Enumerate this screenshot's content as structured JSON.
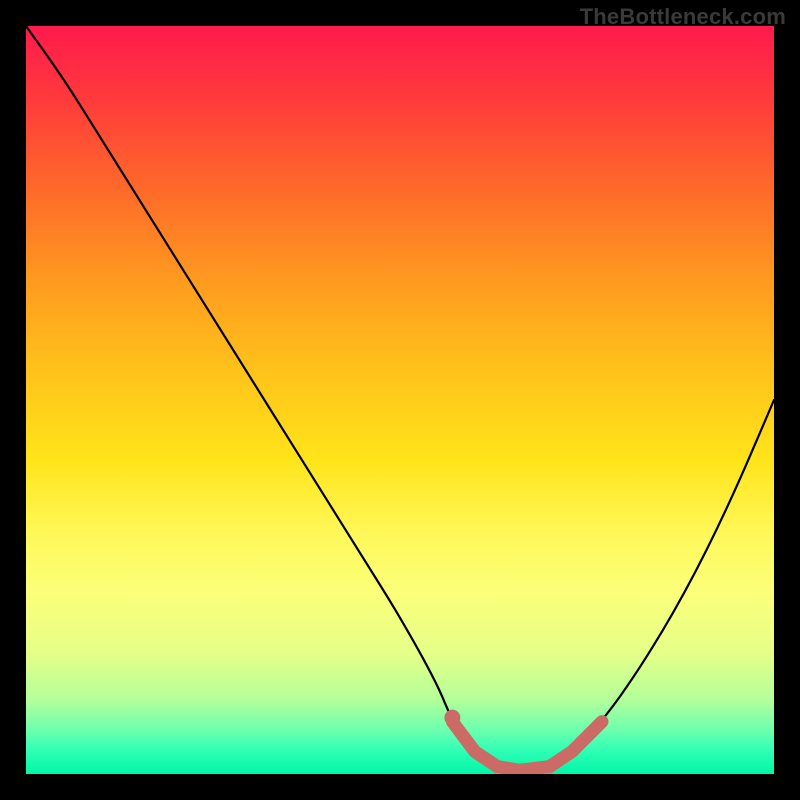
{
  "watermark": "TheBottleneck.com",
  "colors": {
    "curve": "#000000",
    "overlay": "#cc6b66",
    "background_frame": "#000000"
  },
  "chart_data": {
    "type": "line",
    "title": "",
    "xlabel": "",
    "ylabel": "",
    "xlim": [
      0,
      100
    ],
    "ylim": [
      0,
      100
    ],
    "grid": false,
    "legend": false,
    "axes_visible": false,
    "series": [
      {
        "name": "bottleneck-curve",
        "x": [
          0,
          5,
          10,
          15,
          20,
          25,
          30,
          35,
          40,
          45,
          50,
          55,
          57,
          60,
          63,
          66,
          70,
          73,
          77,
          82,
          88,
          94,
          100
        ],
        "y": [
          100,
          93,
          85,
          77,
          69,
          61,
          53,
          45,
          37,
          29,
          21,
          12,
          7,
          3,
          1,
          0.5,
          1,
          3,
          7,
          14,
          24,
          36,
          50
        ]
      }
    ],
    "highlight": {
      "name": "optimal-range",
      "x_start": 57,
      "x_end": 77,
      "y_at_start": 7,
      "y_at_end": 7,
      "minimum_x": 66,
      "minimum_y": 0.5
    },
    "note": "No numeric tick labels or axis text are visible in the image; all domain/range values are inferred from geometry."
  }
}
